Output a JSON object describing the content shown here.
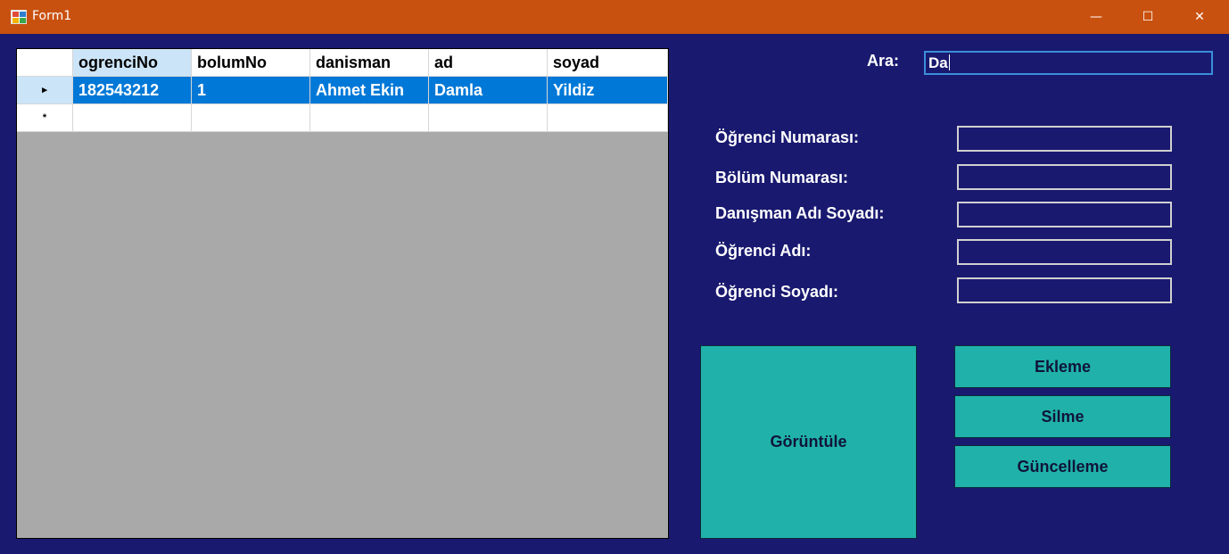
{
  "window": {
    "title": "Form1",
    "minimize_glyph": "—",
    "maximize_glyph": "☐",
    "close_glyph": "✕",
    "icon": "winforms-app-icon"
  },
  "grid": {
    "columns": [
      "ogrenciNo",
      "bolumNo",
      "danisman",
      "ad",
      "soyad"
    ],
    "rows": [
      {
        "indicator": "▸",
        "cells": [
          "182543212",
          "1",
          "Ahmet Ekin",
          "Damla",
          "Yildiz"
        ]
      },
      {
        "indicator": "*",
        "cells": [
          "",
          "",
          "",
          "",
          ""
        ]
      }
    ]
  },
  "search": {
    "label": "Ara:",
    "value": "Da"
  },
  "form": {
    "ogrenci_no_label": "Öğrenci Numarası:",
    "bolum_no_label": "Bölüm Numarası:",
    "danisman_label": "Danışman Adı Soyadı:",
    "ogrenci_adi_label": "Öğrenci Adı:",
    "ogrenci_soyadi_label": "Öğrenci Soyadı:"
  },
  "buttons": {
    "goruntule": "Görüntüle",
    "ekleme": "Ekleme",
    "silme": "Silme",
    "guncelleme": "Güncelleme"
  },
  "colors": {
    "titlebar": "#c9510f",
    "background": "#191970",
    "button": "#20b2aa",
    "selection": "#0078d7"
  }
}
